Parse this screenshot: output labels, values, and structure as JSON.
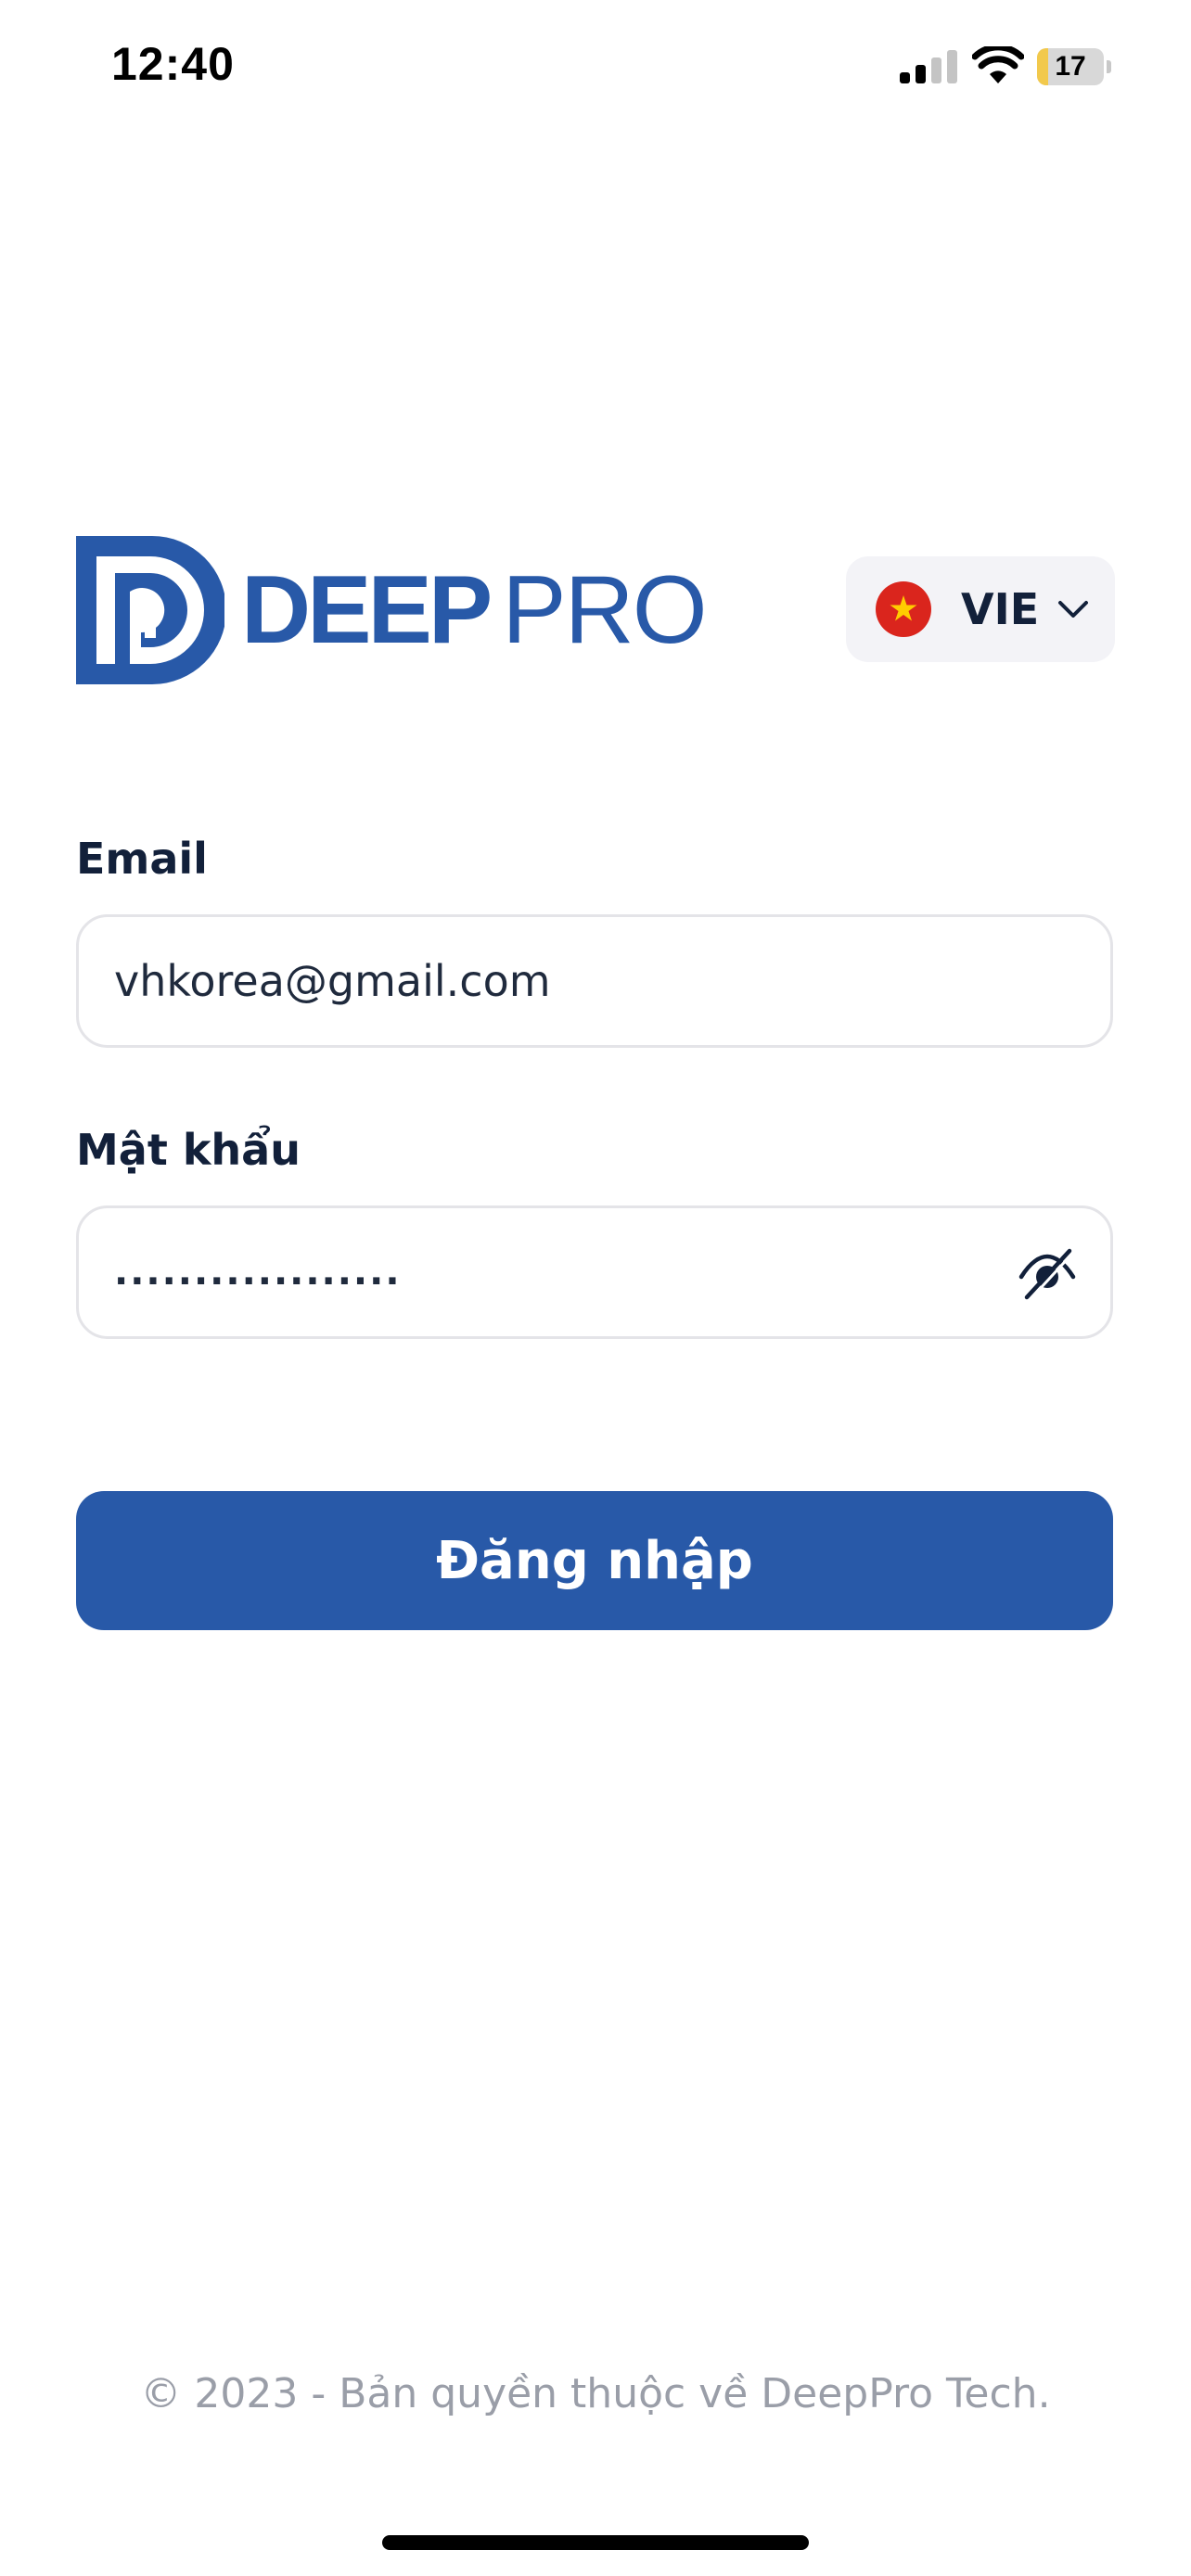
{
  "status_bar": {
    "time": "12:40",
    "battery_percent": "17",
    "battery_level": 0.17,
    "signal_bars_filled": 2,
    "signal_bars_total": 4
  },
  "brand": {
    "logo_bold": "DEEP",
    "logo_light": "PRO",
    "primary_color": "#2859a8"
  },
  "language": {
    "code": "VIE",
    "flag_icon": "vietnam-flag-icon"
  },
  "form": {
    "email_label": "Email",
    "email_value": "vhkorea@gmail.com",
    "password_label": "Mật khẩu",
    "password_masked": "..................",
    "password_toggle_icon": "eye-off-icon"
  },
  "actions": {
    "login_label": "Đăng nhập"
  },
  "footer": {
    "copyright": "© 2023 - Bản quyền thuộc về DeepPro Tech."
  }
}
